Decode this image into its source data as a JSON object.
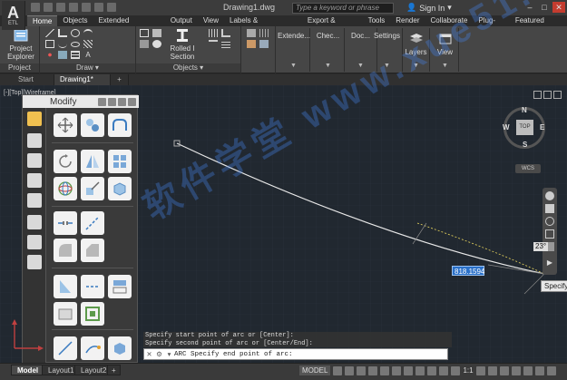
{
  "titlebar": {
    "logo_text": "A",
    "logo_sub": "ETL",
    "doc_title": "Drawing1.dwg",
    "search_placeholder": "Type a keyword or phrase",
    "signin_label": "Sign In"
  },
  "ribbon_tabs": [
    "Home",
    "Objects",
    "Extended Modeling",
    "Output",
    "View",
    "Labels & Dimensions",
    "Export & Import",
    "Tools",
    "Render",
    "Collaborate",
    "Plug-ins",
    "Featured Apps"
  ],
  "ribbon": {
    "project_explorer": "Project Explorer",
    "project_label": "Project",
    "draw_label": "Draw",
    "rolled_section": "Rolled I Section",
    "objects_label": "Objects",
    "extended": "Extende...",
    "check": "Chec...",
    "doc": "Doc...",
    "settings": "Settings",
    "layers": "Layers",
    "view": "View"
  },
  "file_tabs": {
    "start": "Start",
    "drawing": "Drawing1*"
  },
  "viewport": {
    "label": "[-][Top][Wireframe]"
  },
  "viewcube": {
    "n": "N",
    "s": "S",
    "e": "E",
    "w": "W",
    "face": "TOP",
    "wcs": "WCS"
  },
  "palette": {
    "title": "Modify"
  },
  "dynamic": {
    "angle": "23°",
    "length": "818.1594",
    "tooltip": "Specify"
  },
  "watermark": "软件学堂 www.xue51.com",
  "command": {
    "history": [
      "Specify start point of arc or [Center]:",
      "Specify second point of arc or [Center/End]:"
    ],
    "prompt": "ARC Specify end point of arc:"
  },
  "layout_tabs": [
    "Model",
    "Layout1",
    "Layout2"
  ],
  "status": {
    "model": "MODEL",
    "scale": "1:1"
  }
}
